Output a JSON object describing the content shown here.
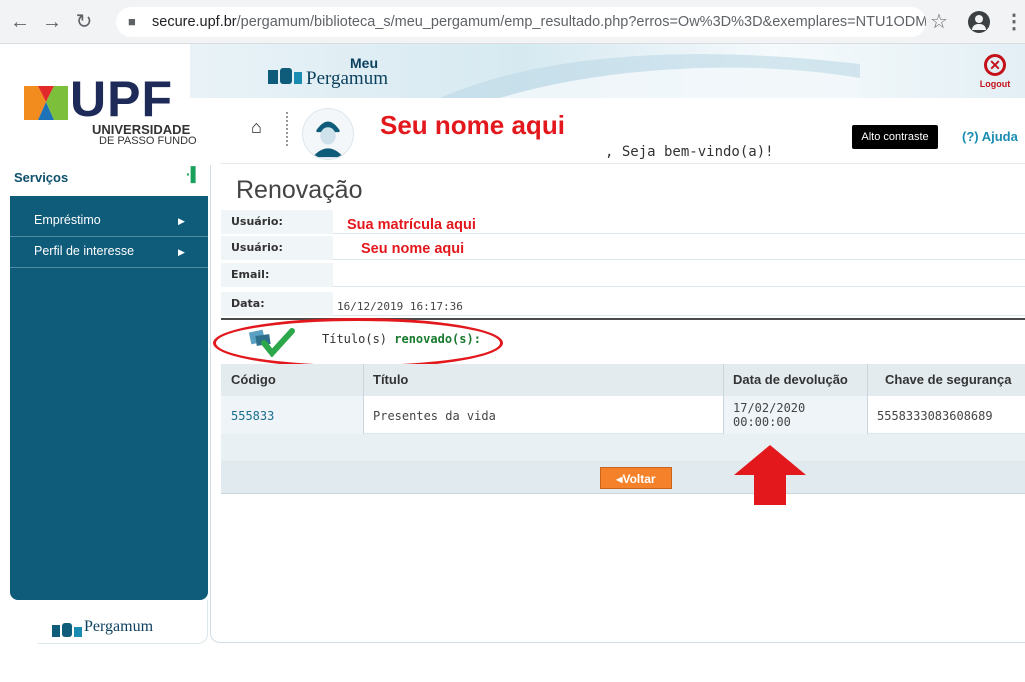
{
  "browser": {
    "url_host": "secure.upf.br",
    "url_path": "/pergamum/biblioteca_s/meu_pergamum/emp_resultado.php?erros=Ow%3D%3D&exemplares=NTU1ODMz...",
    "icons": [
      "back-arrow-icon",
      "forward-arrow-icon",
      "reload-icon",
      "lock-icon",
      "star-icon",
      "account-icon",
      "menu-dots-icon"
    ]
  },
  "header": {
    "logo_text": "UPF",
    "logo_sub1": "UNIVERSIDADE",
    "logo_sub2": "DE PASSO FUNDO",
    "meu_label": "Meu",
    "pergamum_label": "Pergamum",
    "logout_label": "Logout",
    "user_name": "Seu nome aqui",
    "welcome": ", Seja bem-vindo(a)!",
    "contrast_label": "Alto contraste",
    "help_label": "(?) Ajuda"
  },
  "sidebar": {
    "title": "Serviços",
    "items": [
      {
        "label": "Empréstimo"
      },
      {
        "label": "Perfil de interesse"
      }
    ],
    "footer_label": "Pergamum"
  },
  "main": {
    "title": "Renovação",
    "info": {
      "usuario_label": "Usuário:",
      "matricula_value": "Sua matrícula aqui",
      "usuario2_label": "Usuário:",
      "nome_value": "Seu nome aqui",
      "email_label": "Email:",
      "email_value": "",
      "data_label": "Data:",
      "data_value": "16/12/2019 16:17:36"
    },
    "renew_msg_prefix": "Título(s) ",
    "renew_msg_bold": "renovado(s):",
    "table": {
      "headers": [
        "Código",
        "Título",
        "Data de devolução",
        "Chave de segurança"
      ],
      "rows": [
        {
          "codigo": "555833",
          "titulo": "Presentes da vida",
          "data_line1": "17/02/2020",
          "data_line2": "00:00:00",
          "chave": "5558333083608689"
        }
      ]
    },
    "back_button": "Voltar"
  },
  "colors": {
    "brand_teal": "#0e5b7a",
    "annotation_red": "#e3181d",
    "button_orange": "#f5822a"
  }
}
